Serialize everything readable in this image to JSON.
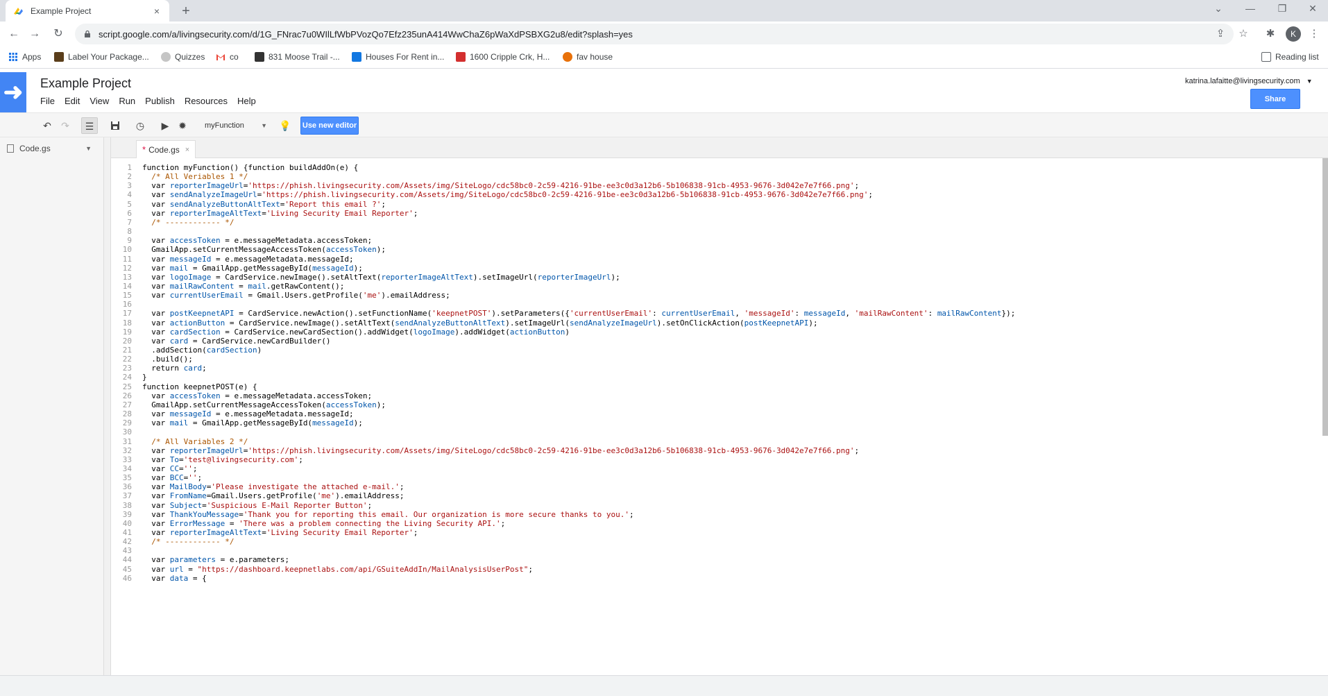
{
  "browser": {
    "tab_title": "Example Project",
    "url": "script.google.com/a/livingsecurity.com/d/1G_FNrac7u0WIlLfWbPVozQo7Efz235unA414WwChaZ6pWaXdPSBXG2u8/edit?splash=yes",
    "profile_initial": "K",
    "bookmarks": [
      {
        "label": "Apps",
        "icon": "apps-grid-icon",
        "color": "#1a73e8"
      },
      {
        "label": "Label Your Package...",
        "icon": "ups-icon",
        "color": "#5a3e1b"
      },
      {
        "label": "Quizzes",
        "icon": "quizzes-icon",
        "color": "#9e9e9e"
      },
      {
        "label": "co",
        "icon": "gmail-icon",
        "color": "#ea4335"
      },
      {
        "label": "831 Moose Trail -...",
        "icon": "realtor-icon",
        "color": "#333333"
      },
      {
        "label": "Houses For Rent in...",
        "icon": "zillow-icon",
        "color": "#1277e1"
      },
      {
        "label": "1600 Cripple Crk, H...",
        "icon": "house-icon",
        "color": "#d32f2f"
      },
      {
        "label": "fav house",
        "icon": "redfin-icon",
        "color": "#e8710a"
      }
    ],
    "reading_list": "Reading list"
  },
  "app": {
    "title": "Example Project",
    "menu": [
      "File",
      "Edit",
      "View",
      "Run",
      "Publish",
      "Resources",
      "Help"
    ],
    "user_email": "katrina.lafaitte@livingsecurity.com",
    "share_label": "Share",
    "function_select": "myFunction",
    "new_editor_label": "Use new editor",
    "file": "Code.gs",
    "editor_tab": "Code.gs",
    "editor_tab_modified": "*"
  },
  "code_lines": [
    [
      {
        "t": "function myFunction() {function buildAddOn(e) {",
        "c": "k"
      }
    ],
    [
      {
        "t": "  /* All Veriables 1 */",
        "c": "c"
      }
    ],
    [
      {
        "t": "  var ",
        "c": "k"
      },
      {
        "t": "reporterImageUrl",
        "c": "v"
      },
      {
        "t": "=",
        "c": "k"
      },
      {
        "t": "'https://phish.livingsecurity.com/Assets/img/SiteLogo/cdc58bc0-2c59-4216-91be-ee3c0d3a12b6-5b106838-91cb-4953-9676-3d042e7e7f66.png'",
        "c": "s"
      },
      {
        "t": ";",
        "c": "k"
      }
    ],
    [
      {
        "t": "  var ",
        "c": "k"
      },
      {
        "t": "sendAnalyzeImageUrl",
        "c": "v"
      },
      {
        "t": "=",
        "c": "k"
      },
      {
        "t": "'https://phish.livingsecurity.com/Assets/img/SiteLogo/cdc58bc0-2c59-4216-91be-ee3c0d3a12b6-5b106838-91cb-4953-9676-3d042e7e7f66.png'",
        "c": "s"
      },
      {
        "t": ";",
        "c": "k"
      }
    ],
    [
      {
        "t": "  var ",
        "c": "k"
      },
      {
        "t": "sendAnalyzeButtonAltText",
        "c": "v"
      },
      {
        "t": "=",
        "c": "k"
      },
      {
        "t": "'Report this email ?'",
        "c": "s"
      },
      {
        "t": ";",
        "c": "k"
      }
    ],
    [
      {
        "t": "  var ",
        "c": "k"
      },
      {
        "t": "reporterImageAltText",
        "c": "v"
      },
      {
        "t": "=",
        "c": "k"
      },
      {
        "t": "'Living Security Email Reporter'",
        "c": "s"
      },
      {
        "t": ";",
        "c": "k"
      }
    ],
    [
      {
        "t": "  /* ------------ */",
        "c": "c"
      }
    ],
    [
      {
        "t": "",
        "c": "k"
      }
    ],
    [
      {
        "t": "  var ",
        "c": "k"
      },
      {
        "t": "accessToken",
        "c": "v"
      },
      {
        "t": " = e.messageMetadata.accessToken;",
        "c": "k"
      }
    ],
    [
      {
        "t": "  GmailApp.setCurrentMessageAccessToken(",
        "c": "k"
      },
      {
        "t": "accessToken",
        "c": "v"
      },
      {
        "t": ");",
        "c": "k"
      }
    ],
    [
      {
        "t": "  var ",
        "c": "k"
      },
      {
        "t": "messageId",
        "c": "v"
      },
      {
        "t": " = e.messageMetadata.messageId;",
        "c": "k"
      }
    ],
    [
      {
        "t": "  var ",
        "c": "k"
      },
      {
        "t": "mail",
        "c": "v"
      },
      {
        "t": " = GmailApp.getMessageById(",
        "c": "k"
      },
      {
        "t": "messageId",
        "c": "v"
      },
      {
        "t": ");",
        "c": "k"
      }
    ],
    [
      {
        "t": "  var ",
        "c": "k"
      },
      {
        "t": "logoImage",
        "c": "v"
      },
      {
        "t": " = CardService.newImage().setAltText(",
        "c": "k"
      },
      {
        "t": "reporterImageAltText",
        "c": "v"
      },
      {
        "t": ").setImageUrl(",
        "c": "k"
      },
      {
        "t": "reporterImageUrl",
        "c": "v"
      },
      {
        "t": ");",
        "c": "k"
      }
    ],
    [
      {
        "t": "  var ",
        "c": "k"
      },
      {
        "t": "mailRawContent",
        "c": "v"
      },
      {
        "t": " = ",
        "c": "k"
      },
      {
        "t": "mail",
        "c": "v"
      },
      {
        "t": ".getRawContent();",
        "c": "k"
      }
    ],
    [
      {
        "t": "  var ",
        "c": "k"
      },
      {
        "t": "currentUserEmail",
        "c": "v"
      },
      {
        "t": " = Gmail.Users.getProfile(",
        "c": "k"
      },
      {
        "t": "'me'",
        "c": "s"
      },
      {
        "t": ").emailAddress;",
        "c": "k"
      }
    ],
    [
      {
        "t": "",
        "c": "k"
      }
    ],
    [
      {
        "t": "  var ",
        "c": "k"
      },
      {
        "t": "postKeepnetAPI",
        "c": "v"
      },
      {
        "t": " = CardService.newAction().setFunctionName(",
        "c": "k"
      },
      {
        "t": "'keepnetPOST'",
        "c": "s"
      },
      {
        "t": ").setParameters({",
        "c": "k"
      },
      {
        "t": "'currentUserEmail'",
        "c": "s"
      },
      {
        "t": ": ",
        "c": "k"
      },
      {
        "t": "currentUserEmail",
        "c": "v"
      },
      {
        "t": ", ",
        "c": "k"
      },
      {
        "t": "'messageId'",
        "c": "s"
      },
      {
        "t": ": ",
        "c": "k"
      },
      {
        "t": "messageId",
        "c": "v"
      },
      {
        "t": ", ",
        "c": "k"
      },
      {
        "t": "'mailRawContent'",
        "c": "s"
      },
      {
        "t": ": ",
        "c": "k"
      },
      {
        "t": "mailRawContent",
        "c": "v"
      },
      {
        "t": "});",
        "c": "k"
      }
    ],
    [
      {
        "t": "  var ",
        "c": "k"
      },
      {
        "t": "actionButton",
        "c": "v"
      },
      {
        "t": " = CardService.newImage().setAltText(",
        "c": "k"
      },
      {
        "t": "sendAnalyzeButtonAltText",
        "c": "v"
      },
      {
        "t": ").setImageUrl(",
        "c": "k"
      },
      {
        "t": "sendAnalyzeImageUrl",
        "c": "v"
      },
      {
        "t": ").setOnClickAction(",
        "c": "k"
      },
      {
        "t": "postKeepnetAPI",
        "c": "v"
      },
      {
        "t": ");",
        "c": "k"
      }
    ],
    [
      {
        "t": "  var ",
        "c": "k"
      },
      {
        "t": "cardSection",
        "c": "v"
      },
      {
        "t": " = CardService.newCardSection().addWidget(",
        "c": "k"
      },
      {
        "t": "logoImage",
        "c": "v"
      },
      {
        "t": ").addWidget(",
        "c": "k"
      },
      {
        "t": "actionButton",
        "c": "v"
      },
      {
        "t": ")",
        "c": "k"
      }
    ],
    [
      {
        "t": "  var ",
        "c": "k"
      },
      {
        "t": "card",
        "c": "v"
      },
      {
        "t": " = CardService.newCardBuilder()",
        "c": "k"
      }
    ],
    [
      {
        "t": "  .addSection(",
        "c": "k"
      },
      {
        "t": "cardSection",
        "c": "v"
      },
      {
        "t": ")",
        "c": "k"
      }
    ],
    [
      {
        "t": "  .build();",
        "c": "k"
      }
    ],
    [
      {
        "t": "  return ",
        "c": "k"
      },
      {
        "t": "card",
        "c": "v"
      },
      {
        "t": ";",
        "c": "k"
      }
    ],
    [
      {
        "t": "}",
        "c": "k"
      }
    ],
    [
      {
        "t": "function keepnetPOST(e) {",
        "c": "k"
      }
    ],
    [
      {
        "t": "  var ",
        "c": "k"
      },
      {
        "t": "accessToken",
        "c": "v"
      },
      {
        "t": " = e.messageMetadata.accessToken;",
        "c": "k"
      }
    ],
    [
      {
        "t": "  GmailApp.setCurrentMessageAccessToken(",
        "c": "k"
      },
      {
        "t": "accessToken",
        "c": "v"
      },
      {
        "t": ");",
        "c": "k"
      }
    ],
    [
      {
        "t": "  var ",
        "c": "k"
      },
      {
        "t": "messageId",
        "c": "v"
      },
      {
        "t": " = e.messageMetadata.messageId;",
        "c": "k"
      }
    ],
    [
      {
        "t": "  var ",
        "c": "k"
      },
      {
        "t": "mail",
        "c": "v"
      },
      {
        "t": " = GmailApp.getMessageById(",
        "c": "k"
      },
      {
        "t": "messageId",
        "c": "v"
      },
      {
        "t": ");",
        "c": "k"
      }
    ],
    [
      {
        "t": "",
        "c": "k"
      }
    ],
    [
      {
        "t": "  /* All Variables 2 */",
        "c": "c"
      }
    ],
    [
      {
        "t": "  var ",
        "c": "k"
      },
      {
        "t": "reporterImageUrl",
        "c": "v"
      },
      {
        "t": "=",
        "c": "k"
      },
      {
        "t": "'https://phish.livingsecurity.com/Assets/img/SiteLogo/cdc58bc0-2c59-4216-91be-ee3c0d3a12b6-5b106838-91cb-4953-9676-3d042e7e7f66.png'",
        "c": "s"
      },
      {
        "t": ";",
        "c": "k"
      }
    ],
    [
      {
        "t": "  var ",
        "c": "k"
      },
      {
        "t": "To",
        "c": "v"
      },
      {
        "t": "=",
        "c": "k"
      },
      {
        "t": "'test@livingsecurity.com'",
        "c": "s"
      },
      {
        "t": ";",
        "c": "k"
      }
    ],
    [
      {
        "t": "  var ",
        "c": "k"
      },
      {
        "t": "CC",
        "c": "v"
      },
      {
        "t": "=",
        "c": "k"
      },
      {
        "t": "''",
        "c": "s"
      },
      {
        "t": ";",
        "c": "k"
      }
    ],
    [
      {
        "t": "  var ",
        "c": "k"
      },
      {
        "t": "BCC",
        "c": "v"
      },
      {
        "t": "=",
        "c": "k"
      },
      {
        "t": "''",
        "c": "s"
      },
      {
        "t": ";",
        "c": "k"
      }
    ],
    [
      {
        "t": "  var ",
        "c": "k"
      },
      {
        "t": "MailBody",
        "c": "v"
      },
      {
        "t": "=",
        "c": "k"
      },
      {
        "t": "'Please investigate the attached e-mail.'",
        "c": "s"
      },
      {
        "t": ";",
        "c": "k"
      }
    ],
    [
      {
        "t": "  var ",
        "c": "k"
      },
      {
        "t": "FromName",
        "c": "v"
      },
      {
        "t": "=Gmail.Users.getProfile(",
        "c": "k"
      },
      {
        "t": "'me'",
        "c": "s"
      },
      {
        "t": ").emailAddress;",
        "c": "k"
      }
    ],
    [
      {
        "t": "  var ",
        "c": "k"
      },
      {
        "t": "Subject",
        "c": "v"
      },
      {
        "t": "=",
        "c": "k"
      },
      {
        "t": "'Suspicious E-Mail Reporter Button'",
        "c": "s"
      },
      {
        "t": ";",
        "c": "k"
      }
    ],
    [
      {
        "t": "  var ",
        "c": "k"
      },
      {
        "t": "ThankYouMessage",
        "c": "v"
      },
      {
        "t": "=",
        "c": "k"
      },
      {
        "t": "'Thank you for reporting this email. Our organization is more secure thanks to you.'",
        "c": "s"
      },
      {
        "t": ";",
        "c": "k"
      }
    ],
    [
      {
        "t": "  var ",
        "c": "k"
      },
      {
        "t": "ErrorMessage",
        "c": "v"
      },
      {
        "t": " = ",
        "c": "k"
      },
      {
        "t": "'There was a problem connecting the Living Security API.'",
        "c": "s"
      },
      {
        "t": ";",
        "c": "k"
      }
    ],
    [
      {
        "t": "  var ",
        "c": "k"
      },
      {
        "t": "reporterImageAltText",
        "c": "v"
      },
      {
        "t": "=",
        "c": "k"
      },
      {
        "t": "'Living Security Email Reporter'",
        "c": "s"
      },
      {
        "t": ";",
        "c": "k"
      }
    ],
    [
      {
        "t": "  /* ------------ */",
        "c": "c"
      }
    ],
    [
      {
        "t": "",
        "c": "k"
      }
    ],
    [
      {
        "t": "  var ",
        "c": "k"
      },
      {
        "t": "parameters",
        "c": "v"
      },
      {
        "t": " = e.parameters;",
        "c": "k"
      }
    ],
    [
      {
        "t": "  var ",
        "c": "k"
      },
      {
        "t": "url",
        "c": "v"
      },
      {
        "t": " = ",
        "c": "k"
      },
      {
        "t": "\"https://dashboard.keepnetlabs.com/api/GSuiteAddIn/MailAnalysisUserPost\"",
        "c": "s"
      },
      {
        "t": ";",
        "c": "k"
      }
    ],
    [
      {
        "t": "  var ",
        "c": "k"
      },
      {
        "t": "data",
        "c": "v"
      },
      {
        "t": " = {",
        "c": "k"
      }
    ]
  ]
}
